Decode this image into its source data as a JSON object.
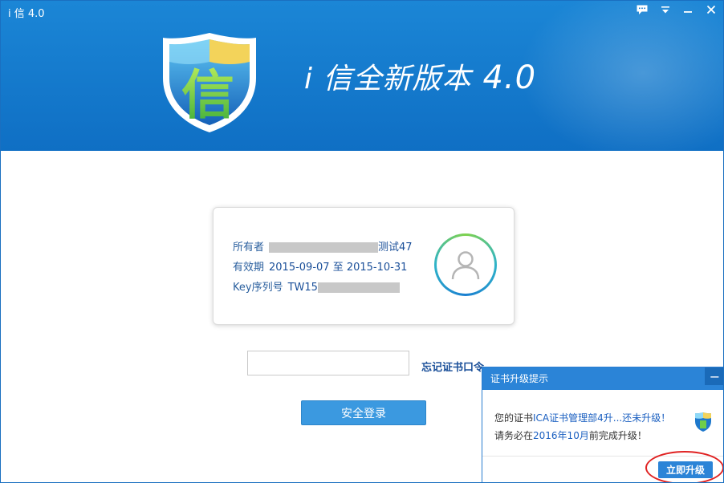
{
  "window": {
    "title": "i 信 4.0",
    "controls": [
      "message-icon",
      "menu-icon",
      "minimize-icon",
      "close-icon"
    ]
  },
  "header": {
    "logo_char": "信",
    "headline": "i 信全新版本",
    "version": "4.0",
    "colors": {
      "bg": "#1479cf",
      "text": "#ffffff"
    }
  },
  "cert_card": {
    "owner_label": "所有者",
    "owner_suffix": "测试47",
    "valid_label": "有效期",
    "valid_value": "2015-09-07 至 2015-10-31",
    "key_label": "Key序列号",
    "key_prefix": "TW15"
  },
  "login": {
    "password_placeholder": "",
    "forgot_label": "忘记证书口令",
    "login_button": "安全登录"
  },
  "popup": {
    "title": "证书升级提示",
    "minimize": "−",
    "line1_a": "您的证书",
    "line1_hl": "ICA证书管理部4升...还未升级！",
    "line2_a": "请务必在",
    "line2_hl": "2016年10月",
    "line2_b": "前完成升级！",
    "button": "立即升级"
  }
}
